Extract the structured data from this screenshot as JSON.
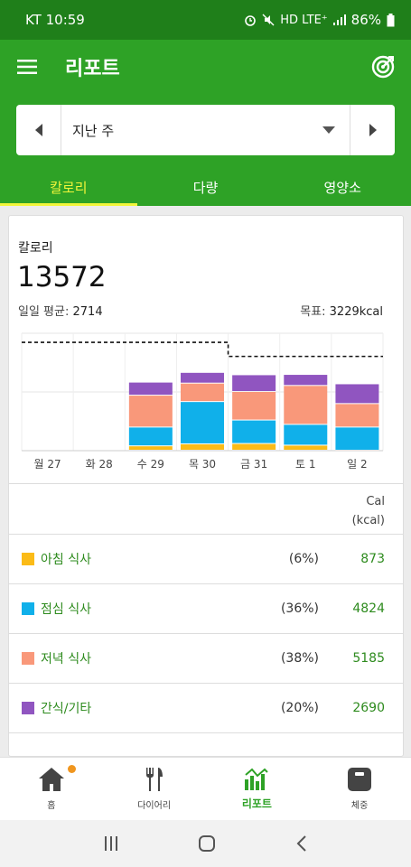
{
  "status_bar": {
    "carrier_time": "KT 10:59",
    "network": "HD LTE⁺",
    "battery": "86%"
  },
  "app_bar": {
    "title": "리포트"
  },
  "period": {
    "selected": "지난 주"
  },
  "tabs": [
    {
      "label": "칼로리",
      "active": true
    },
    {
      "label": "다량",
      "active": false
    },
    {
      "label": "영양소",
      "active": false
    }
  ],
  "summary": {
    "label": "칼로리",
    "total": "13572",
    "daily_avg_label": "일일 평균:",
    "daily_avg_value": "2714",
    "goal_label": "목표:",
    "goal_value": "3229kcal"
  },
  "chart_data": {
    "type": "bar",
    "stacked": true,
    "categories": [
      "월 27",
      "화 28",
      "수 29",
      "목 30",
      "금 31",
      "토 1",
      "일 2"
    ],
    "series": [
      {
        "name": "아침 식사",
        "color": "#fbbb17",
        "values": [
          0,
          0,
          130,
          190,
          200,
          150,
          0
        ]
      },
      {
        "name": "점심 식사",
        "color": "#10b0ea",
        "values": [
          0,
          0,
          560,
          1260,
          700,
          620,
          690
        ]
      },
      {
        "name": "저녁 식사",
        "color": "#f9987a",
        "values": [
          0,
          0,
          950,
          550,
          850,
          1160,
          700
        ]
      },
      {
        "name": "간식/기타",
        "color": "#9055c0",
        "values": [
          0,
          0,
          390,
          320,
          500,
          330,
          590
        ]
      }
    ],
    "goal_line": [
      3229,
      3229,
      3229,
      3229,
      2810,
      2810,
      2810
    ],
    "ylim": [
      0,
      3500
    ],
    "grid": true
  },
  "table": {
    "unit_line1": "Cal",
    "unit_line2": "(kcal)",
    "rows": [
      {
        "name": "아침 식사",
        "pct": "(6%)",
        "cal": "873",
        "color": "#fbbb17"
      },
      {
        "name": "점심 식사",
        "pct": "(36%)",
        "cal": "4824",
        "color": "#10b0ea"
      },
      {
        "name": "저녁 식사",
        "pct": "(38%)",
        "cal": "5185",
        "color": "#f9987a"
      },
      {
        "name": "간식/기타",
        "pct": "(20%)",
        "cal": "2690",
        "color": "#9055c0"
      }
    ]
  },
  "bottom_nav": [
    {
      "label": "홈",
      "icon": "home-icon"
    },
    {
      "label": "다이어리",
      "icon": "fork-knife-icon"
    },
    {
      "label": "리포트",
      "icon": "report-chart-icon",
      "active": true
    },
    {
      "label": "체중",
      "icon": "scale-icon"
    }
  ]
}
